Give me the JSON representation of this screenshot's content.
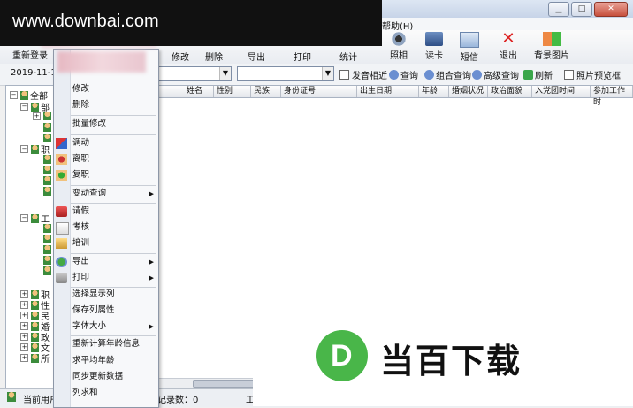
{
  "banner": {
    "text": "www.downbai.com"
  },
  "menubar": {
    "help": "帮助(H)"
  },
  "toolbar": {
    "left_label": "重新登录",
    "items": [
      "修改",
      "删除",
      "导出",
      "打印",
      "统计",
      "照相",
      "读卡",
      "短信",
      "退出",
      "背景图片"
    ]
  },
  "filterbar": {
    "date": "2019-11-15",
    "combo1": "",
    "combo2": "",
    "checkbox_birthday": "发音相近",
    "btn_query": "查询",
    "btn_combo_query": "组合查询",
    "btn_adv_query": "高级查询",
    "btn_refresh": "刷新",
    "checkbox_photo": "照片预览框"
  },
  "tree": {
    "root": "全部",
    "nodes": [
      "部",
      "职",
      "工",
      "职",
      "性",
      "民",
      "婚",
      "政",
      "文",
      "所"
    ]
  },
  "grid": {
    "columns": [
      "姓名",
      "性别",
      "民族",
      "身份证号",
      "出生日期",
      "年龄",
      "婚姻状况",
      "政治面貌",
      "入党团时间",
      "参加工作时"
    ]
  },
  "context_menu": {
    "items": [
      {
        "label": "修改"
      },
      {
        "label": "删除"
      },
      {
        "label": "批量修改"
      },
      {
        "label": "调动"
      },
      {
        "label": "离职"
      },
      {
        "label": "复职"
      },
      {
        "label": "变动查询",
        "submenu": true
      },
      {
        "label": "请假"
      },
      {
        "label": "考核"
      },
      {
        "label": "培训"
      },
      {
        "label": "导出",
        "submenu": true
      },
      {
        "label": "打印",
        "submenu": true
      },
      {
        "label": "选择显示列"
      },
      {
        "label": "保存列属性"
      },
      {
        "label": "字体大小",
        "submenu": true
      },
      {
        "label": "重新计算年龄信息"
      },
      {
        "label": "求平均年龄"
      },
      {
        "label": "同步更新数据"
      },
      {
        "label": "列求和"
      }
    ]
  },
  "statusbar": {
    "user_label": "当前用户",
    "record_label": "记录数：0",
    "trailing": "工"
  },
  "logo": {
    "letter": "D",
    "text": "当百下载",
    "color": "#49b649"
  }
}
